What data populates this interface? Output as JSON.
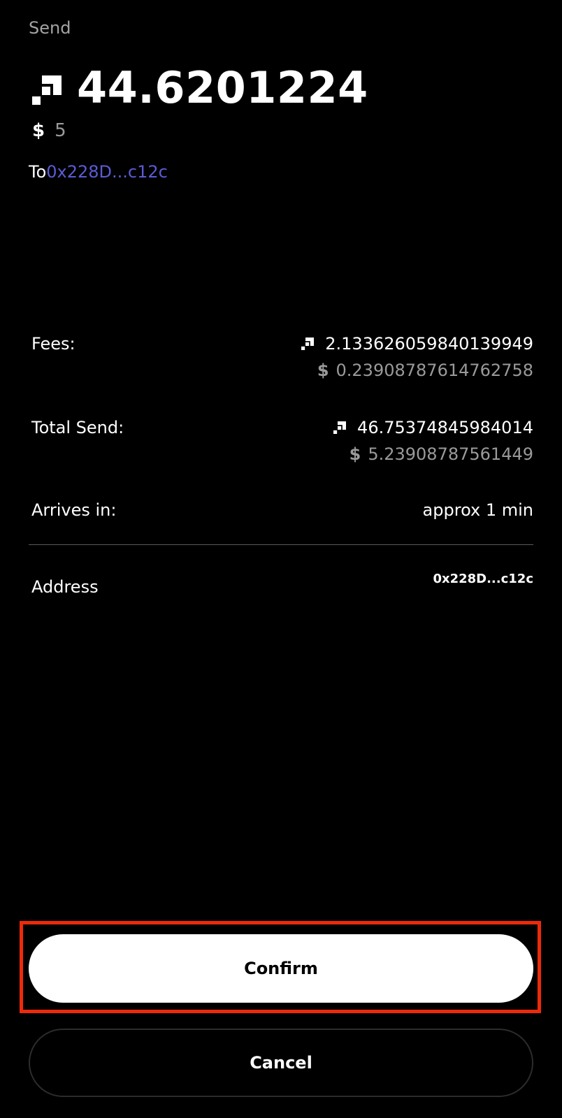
{
  "header": {
    "title": "Send"
  },
  "amount": {
    "token_icon": "token-arrow-icon",
    "value": "44.6201224",
    "fiat_symbol": "$",
    "fiat_value": "5"
  },
  "recipient": {
    "label": "To",
    "address": "0x228D...c12c"
  },
  "details": {
    "fees": {
      "label": "Fees:",
      "token_value": "2.133626059840139949",
      "fiat_symbol": "$",
      "fiat_value": "0.23908787614762758"
    },
    "total_send": {
      "label": "Total Send:",
      "token_value": "46.75374845984014",
      "fiat_symbol": "$",
      "fiat_value": "5.23908787561449"
    },
    "arrives_in": {
      "label": "Arrives in:",
      "value": "approx 1 min"
    },
    "address": {
      "label": "Address",
      "value": "0x228D...c12c"
    }
  },
  "actions": {
    "confirm_label": "Confirm",
    "cancel_label": "Cancel"
  },
  "colors": {
    "background": "#000000",
    "link": "#5b5bd6",
    "muted": "#9a9a9a",
    "highlight": "#ee2a0b"
  }
}
